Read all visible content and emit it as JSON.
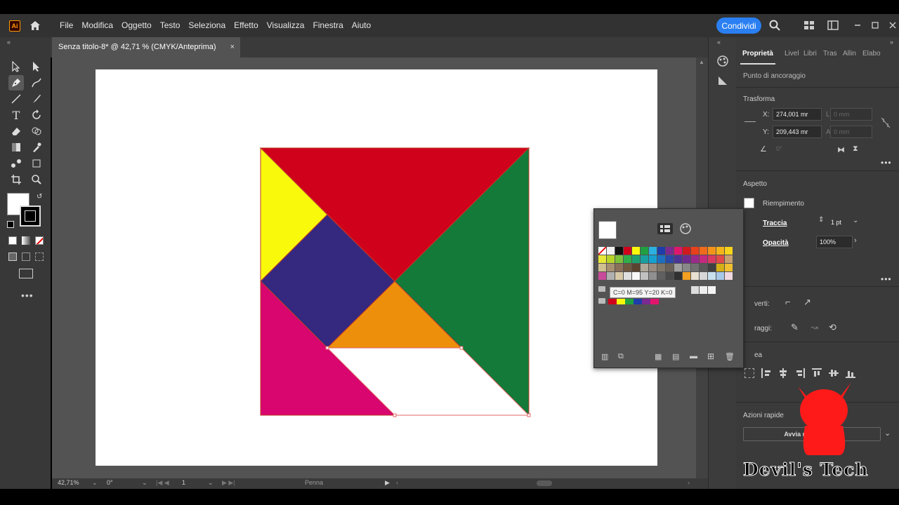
{
  "app": {
    "logo_text": "Ai"
  },
  "menu": [
    "File",
    "Modifica",
    "Oggetto",
    "Testo",
    "Seleziona",
    "Effetto",
    "Visualizza",
    "Finestra",
    "Aiuto"
  ],
  "share_label": "Condividi",
  "document_tab": {
    "title": "Senza titolo-8* @ 42,71 % (CMYK/Anteprima)",
    "close": "×"
  },
  "status": {
    "zoom": "42,71%",
    "angle": "0°",
    "artboard": "1",
    "tool": "Penna"
  },
  "properties": {
    "tabs": [
      "Proprietà",
      "Livel",
      "Libri",
      "Tras",
      "Allin",
      "Elabo"
    ],
    "anchor_label": "Punto di ancoraggio",
    "transform_label": "Trasforma",
    "x_label": "X:",
    "x_value": "274,001 mr",
    "y_label": "Y:",
    "y_value": "209,443 mr",
    "w_label": "L:",
    "w_value": "0 mm",
    "h_label": "A:",
    "h_value": "0 mm",
    "angle_value": "0°",
    "appearance_label": "Aspetto",
    "fill_label": "Riempimento",
    "stroke_label": "Traccia",
    "stroke_value": "1 pt",
    "opacity_label": "Opacità",
    "opacity_value": "100%",
    "convert_label": "verti:",
    "handles_label": "raggi:",
    "align_label": "ea",
    "quick_actions_label": "Azioni rapide",
    "quick_action_button": "Avvia m",
    "quick_action_button_end": "ale"
  },
  "swatch_tooltip": "C=0 M=95 Y=20 K=0",
  "watermark": "Devil's Tech",
  "colors": {
    "red": "#d0021b",
    "green": "#137a3a",
    "yellow": "#f9f90c",
    "purple": "#35287f",
    "orange": "#ed8f0b",
    "magenta": "#d8066e",
    "share": "#2a7ff2"
  },
  "swatches": [
    "#ffffff",
    "#f0f0f0",
    "#111111",
    "#d0021b",
    "#f9f90c",
    "#20a040",
    "#2bb0e0",
    "#1e3caa",
    "#7a2a90",
    "#e0166e",
    "#d01a20",
    "#e8401c",
    "#f06a1c",
    "#f2941a",
    "#f4b51a",
    "#f7d41c",
    "#e8e836",
    "#b8d42a",
    "#7dc03a",
    "#2fae4a",
    "#20a070",
    "#18a0a0",
    "#16a0d0",
    "#1c70c0",
    "#2a48a8",
    "#4a3496",
    "#6e2c8e",
    "#9a2a8a",
    "#c42a7e",
    "#d83a60",
    "#e04a48",
    "#c8a070",
    "#d0c090",
    "#a89070",
    "#8a7058",
    "#70583e",
    "#5a4430",
    "#b0a898",
    "#988c80",
    "#7e7468",
    "#6a6058",
    "#a0a0a0",
    "#888888",
    "#707070",
    "#585858",
    "#404040",
    "#d4b016",
    "#f0c030",
    "#c84a9a",
    "#b0b0b0",
    "#d8c8a8",
    "#e0e0e0",
    "#f8f8f8",
    "#c0c0c0",
    "#909090",
    "#606060",
    "#4a4a4a",
    "#303030",
    "#f4a020",
    "#e8e0d0",
    "#d8d8d8",
    "#c8e0f0",
    "#a8c8e8",
    "#f0d8e0"
  ]
}
